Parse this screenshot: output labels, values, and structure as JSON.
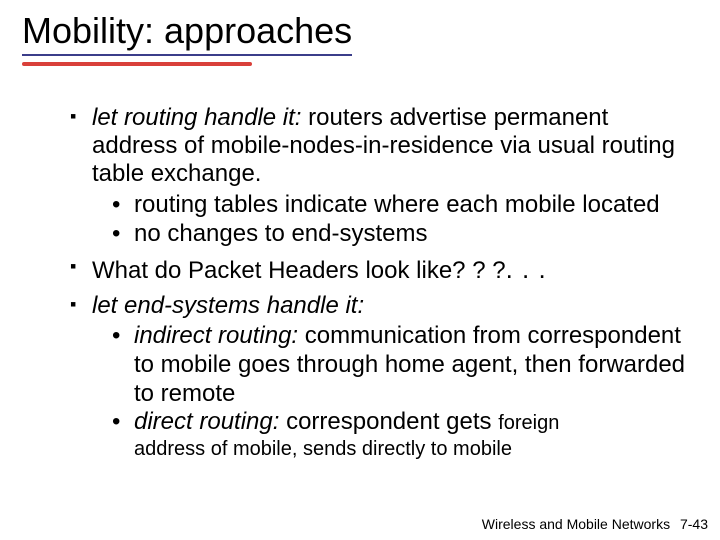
{
  "title": "Mobility: approaches",
  "bullets": {
    "b1": {
      "lead": "let routing handle it:",
      "rest": " routers advertise permanent address of mobile-nodes-in-residence via usual routing table exchange.",
      "sub1": "routing tables indicate where each mobile located",
      "sub2": "no changes to end-systems"
    },
    "b2": {
      "text": "What do Packet Headers look like? ? ?",
      "dots": ". . ."
    },
    "b3": {
      "lead": "let end-systems handle it:",
      "sub1_lead": "indirect routing:",
      "sub1_rest": " communication from correspondent to mobile goes through home agent, then forwarded to remote",
      "sub2_lead": "direct routing:",
      "sub2_rest_a": " correspondent gets ",
      "sub2_foreign": "foreign",
      "sub2_rest_b": "address of mobile, sends directly to mobile"
    }
  },
  "footer": {
    "label": "Wireless and Mobile Networks",
    "page": "7-43"
  }
}
